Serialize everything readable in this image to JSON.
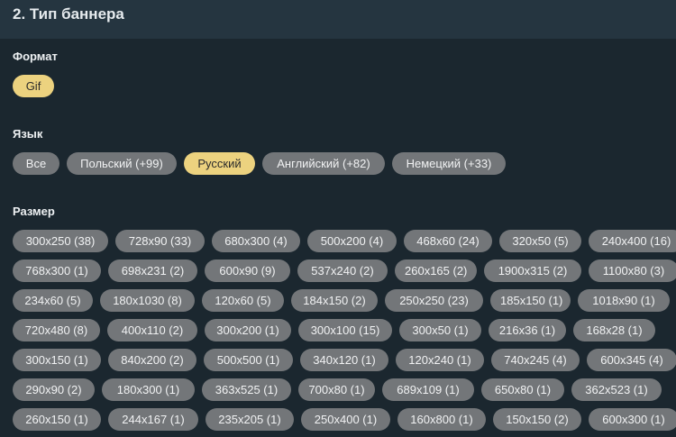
{
  "header": {
    "title": "2. Тип баннера"
  },
  "format": {
    "label": "Формат",
    "options": [
      {
        "label": "Gif",
        "active": true
      }
    ]
  },
  "language": {
    "label": "Язык",
    "options": [
      {
        "label": "Все",
        "active": false
      },
      {
        "label": "Польский (+99)",
        "active": false
      },
      {
        "label": "Русский",
        "active": true
      },
      {
        "label": "Английский (+82)",
        "active": false
      },
      {
        "label": "Немецкий (+33)",
        "active": false
      }
    ]
  },
  "size": {
    "label": "Размер",
    "rows": [
      [
        "300x250 (38)",
        "728x90 (33)",
        "680x300 (4)",
        "500x200 (4)",
        "468x60 (24)",
        "320x50 (5)",
        "240x400 (16)"
      ],
      [
        "768x300 (1)",
        "698x231 (2)",
        "600x90 (9)",
        "537x240 (2)",
        "260x165 (2)",
        "1900x315 (2)",
        "1100x80 (3)"
      ],
      [
        "234x60 (5)",
        "180x1030 (8)",
        "120x60 (5)",
        "184x150 (2)",
        "250x250 (23)",
        "185x150 (1)",
        "1018x90 (1)"
      ],
      [
        "720x480 (8)",
        "400x110 (2)",
        "300x200 (1)",
        "300x100 (15)",
        "300x50 (1)",
        "216x36 (1)",
        "168x28 (1)"
      ],
      [
        "300x150 (1)",
        "840x200 (2)",
        "500x500 (1)",
        "340x120 (1)",
        "120x240 (1)",
        "740x245 (4)",
        "600x345 (4)"
      ],
      [
        "290x90 (2)",
        "180x300 (1)",
        "363x525 (1)",
        "700x80 (1)",
        "689x109 (1)",
        "650x80 (1)",
        "362x523 (1)"
      ],
      [
        "260x150 (1)",
        "244x167 (1)",
        "235x205 (1)",
        "250x400 (1)",
        "160x800 (1)",
        "150x150 (2)",
        "600x300 (1)"
      ]
    ]
  }
}
